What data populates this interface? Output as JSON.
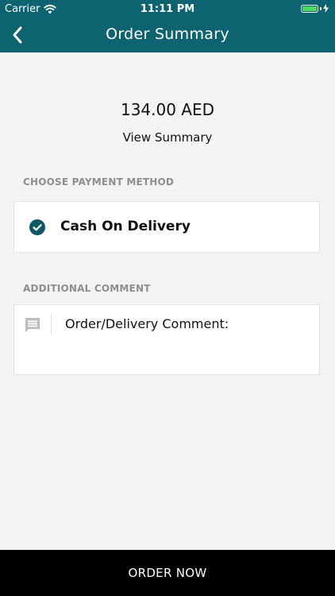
{
  "status_bar": {
    "carrier": "Carrier",
    "time": "11:11 PM"
  },
  "header": {
    "title": "Order Summary",
    "back_icon": "chevron-left-icon"
  },
  "summary": {
    "amount": "134.00 AED",
    "view_summary": "View Summary"
  },
  "payment": {
    "section_label": "CHOOSE PAYMENT METHOD",
    "selected_method": "Cash On Delivery",
    "icon": "check-circle-icon"
  },
  "comment": {
    "section_label": "ADDITIONAL COMMENT",
    "placeholder": "Order/Delivery Comment:",
    "icon": "chat-bubble-icon"
  },
  "footer": {
    "order_button": "ORDER NOW"
  },
  "colors": {
    "header_bg": "#0d6470",
    "accent": "#0d5864",
    "page_bg": "#f3f3f3",
    "button_bg": "#000000",
    "battery": "#4cd964"
  }
}
